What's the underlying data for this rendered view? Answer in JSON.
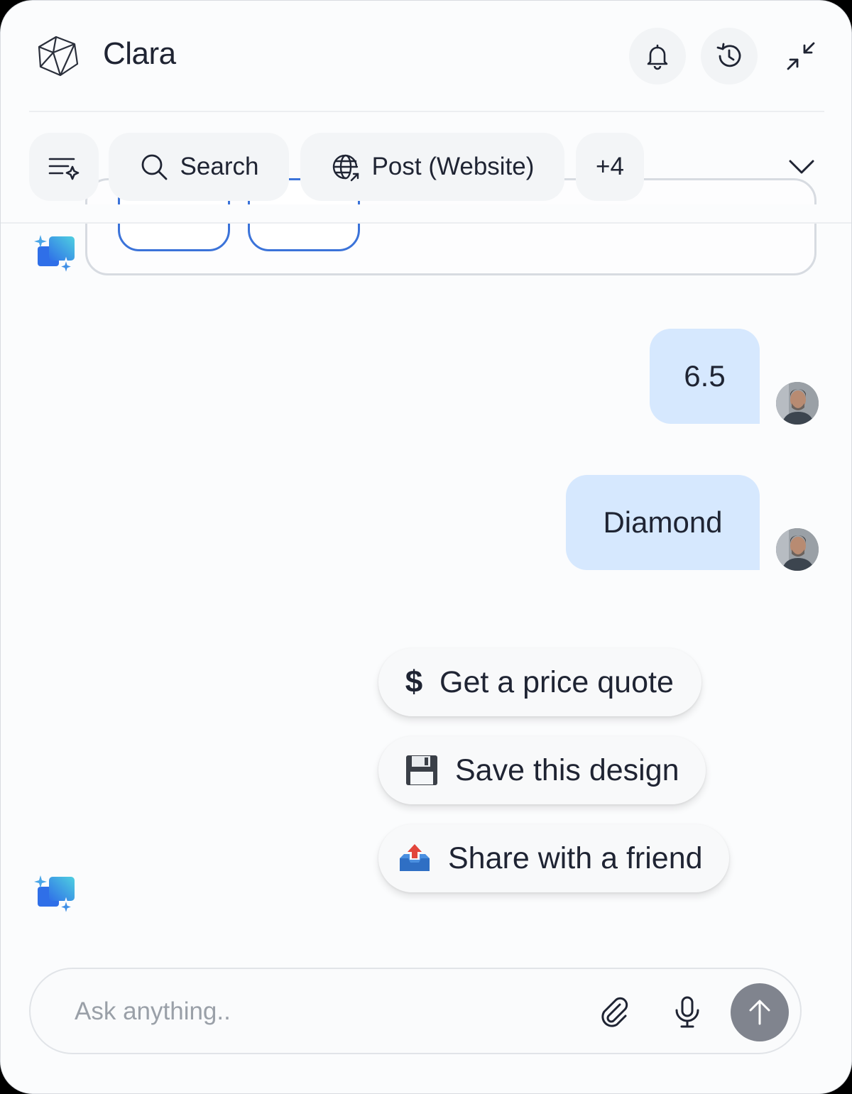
{
  "header": {
    "title": "Clara",
    "logo_icon": "polyhedron-logo-icon",
    "actions": [
      "bell-icon",
      "history-icon",
      "minimize-icon"
    ]
  },
  "toolbar": {
    "filter_icon": "filter-sparkle-icon",
    "search_label": "Search",
    "post_label": "Post (Website)",
    "more_label": "+4",
    "expand_icon": "chevron-down-icon"
  },
  "messages": [
    {
      "role": "user",
      "text": "6.5"
    },
    {
      "role": "user",
      "text": "Diamond"
    }
  ],
  "suggestions": [
    {
      "icon": "dollar-icon",
      "label": "Get a price quote"
    },
    {
      "icon": "floppy-disk-icon",
      "label": "Save this design"
    },
    {
      "icon": "outbox-tray-icon",
      "label": "Share with a friend"
    }
  ],
  "composer": {
    "placeholder": "Ask anything..",
    "value": ""
  },
  "colors": {
    "user_bubble": "#d6e8fe",
    "send_button": "#80848e",
    "option_border": "#3b73d9"
  }
}
